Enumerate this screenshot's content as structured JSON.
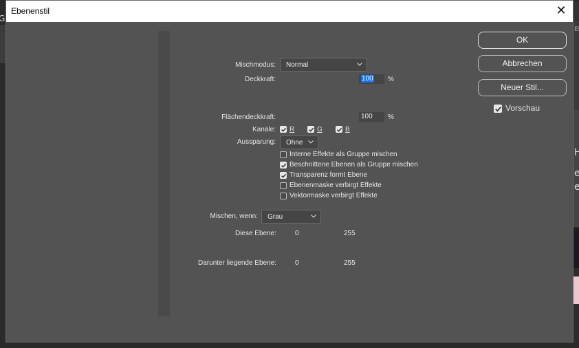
{
  "dialog": {
    "title": "Ebenenstil",
    "close_glyph": "✕"
  },
  "background_app": {
    "left_glyph": "G",
    "right_texts": [
      "Eb",
      "H",
      "ei",
      "e"
    ]
  },
  "blending": {
    "blend_mode_label": "Mischmodus:",
    "blend_mode_value": "Normal",
    "opacity_label": "Deckkraft:",
    "opacity_value": "100",
    "opacity_unit": "%",
    "fill_opacity_label": "Flächendeckkraft:",
    "fill_opacity_value": "100",
    "fill_opacity_unit": "%",
    "channels_label": "Kanäle:",
    "channels": [
      {
        "label": "R",
        "checked": true
      },
      {
        "label": "G",
        "checked": true
      },
      {
        "label": "B",
        "checked": true
      }
    ],
    "knockout_label": "Aussparung:",
    "knockout_value": "Ohne",
    "options": [
      {
        "label": "Interne Effekte als Gruppe mischen",
        "checked": false
      },
      {
        "label": "Beschnittene Ebenen als Gruppe mischen",
        "checked": true
      },
      {
        "label": "Transparenz formt Ebene",
        "checked": true
      },
      {
        "label": "Ebenenmaske verbirgt Effekte",
        "checked": false
      },
      {
        "label": "Vektormaske verbirgt Effekte",
        "checked": false
      }
    ],
    "blend_if_label": "Mischen, wenn:",
    "blend_if_value": "Grau",
    "this_layer_label": "Diese Ebene:",
    "this_layer_min": "0",
    "this_layer_max": "255",
    "underlying_label": "Darunter liegende Ebene:",
    "underlying_min": "0",
    "underlying_max": "255"
  },
  "buttons": {
    "ok": "OK",
    "cancel": "Abbrechen",
    "new_style": "Neuer Stil...",
    "preview_label": "Vorschau",
    "preview_checked": true
  },
  "colors": {
    "dialog_bg": "#535353",
    "titlebar_bg": "#ffffff",
    "selection": "#1a73e8"
  }
}
